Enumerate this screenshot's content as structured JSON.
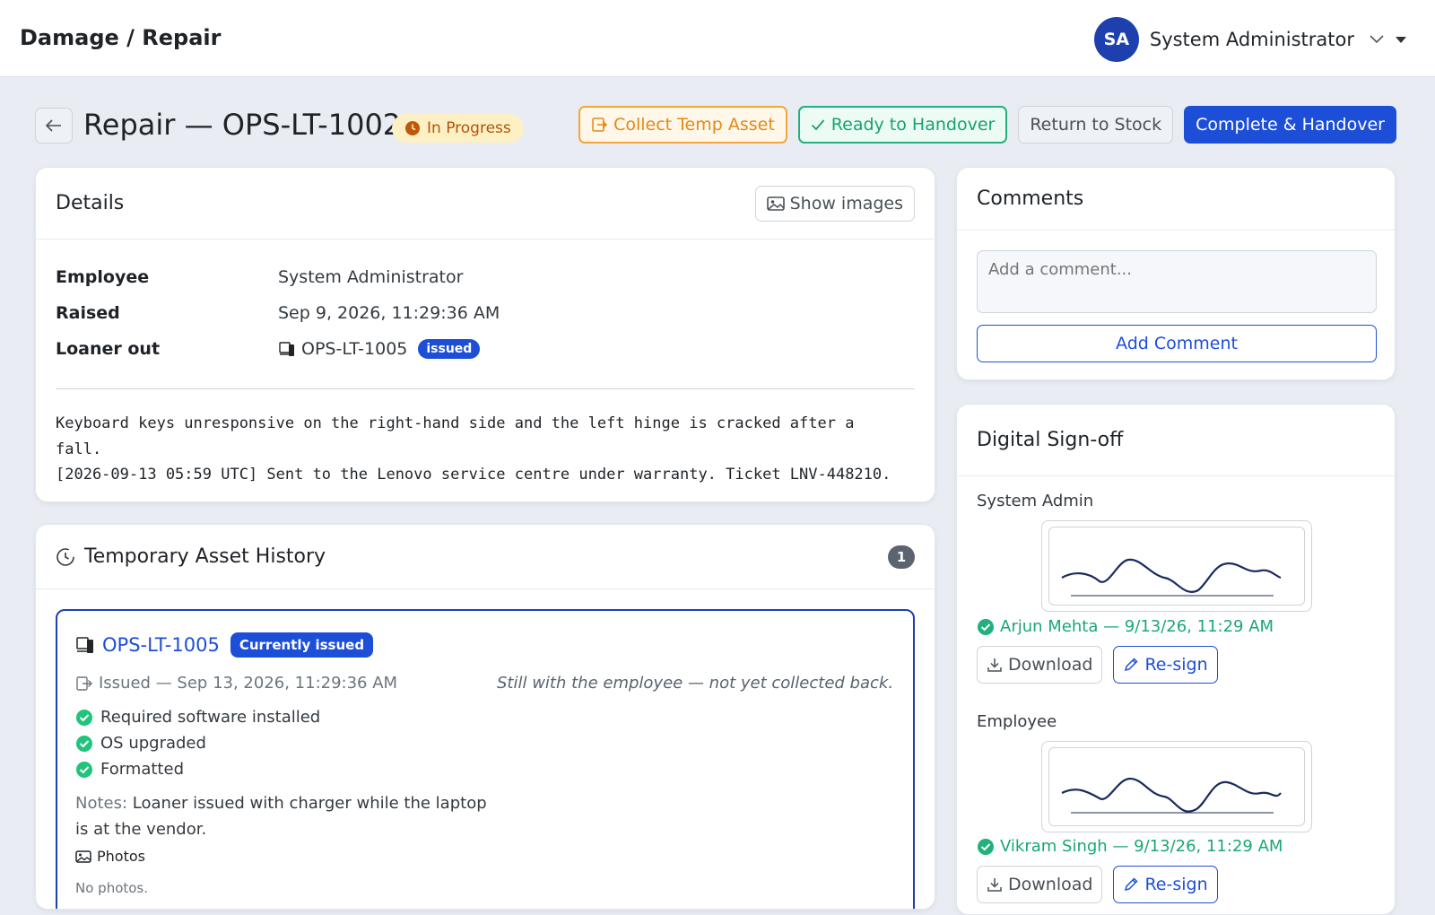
{
  "app": {
    "title": "Damage / Repair"
  },
  "user": {
    "initials": "SA",
    "name": "System Administrator"
  },
  "page": {
    "title": "Repair — OPS-LT-1002",
    "status": "In Progress"
  },
  "actions": {
    "collect_temp": "Collect Temp Asset",
    "ready_handover": "Ready to Handover",
    "return_stock": "Return to Stock",
    "complete_handover": "Complete & Handover"
  },
  "details": {
    "title": "Details",
    "show_images": "Show images",
    "rows": [
      {
        "label": "Employee",
        "value": "System Administrator"
      },
      {
        "label": "Raised",
        "value": "Sep 9, 2026, 11:29:36 AM"
      },
      {
        "label": "Loaner out",
        "value": "OPS-LT-1005",
        "badge": "issued"
      }
    ],
    "description": "Keyboard keys unresponsive on the right-hand side and the left hinge is cracked after a\nfall.\n[2026-09-13 05:59 UTC] Sent to the Lenovo service centre under warranty. Ticket LNV-448210."
  },
  "history": {
    "title": "Temporary Asset History",
    "count": "1",
    "entry": {
      "asset": "OPS-LT-1005",
      "badge": "Currently issued",
      "issued": "Issued — Sep 13, 2026, 11:29:36 AM",
      "status_note": "Still with the employee — not yet collected back.",
      "checks": [
        "Required software installed",
        "OS upgraded",
        "Formatted"
      ],
      "notes_label": "Notes:",
      "notes": "Loaner issued with charger while the laptop is at the vendor.",
      "photos_label": "Photos",
      "no_photos": "No photos."
    }
  },
  "comments": {
    "title": "Comments",
    "placeholder": "Add a comment...",
    "add_label": "Add Comment"
  },
  "signoff": {
    "title": "Digital Sign-off",
    "download_label": "Download",
    "resign_label": "Re-sign",
    "signers": [
      {
        "role": "System Admin",
        "signed_by": "Arjun Mehta — 9/13/26, 11:29 AM"
      },
      {
        "role": "Employee",
        "signed_by": "Vikram Singh — 9/13/26, 11:29 AM"
      }
    ]
  },
  "colors": {
    "primary": "#1d4ed8",
    "success": "#19a872",
    "warning": "#e28a12"
  }
}
